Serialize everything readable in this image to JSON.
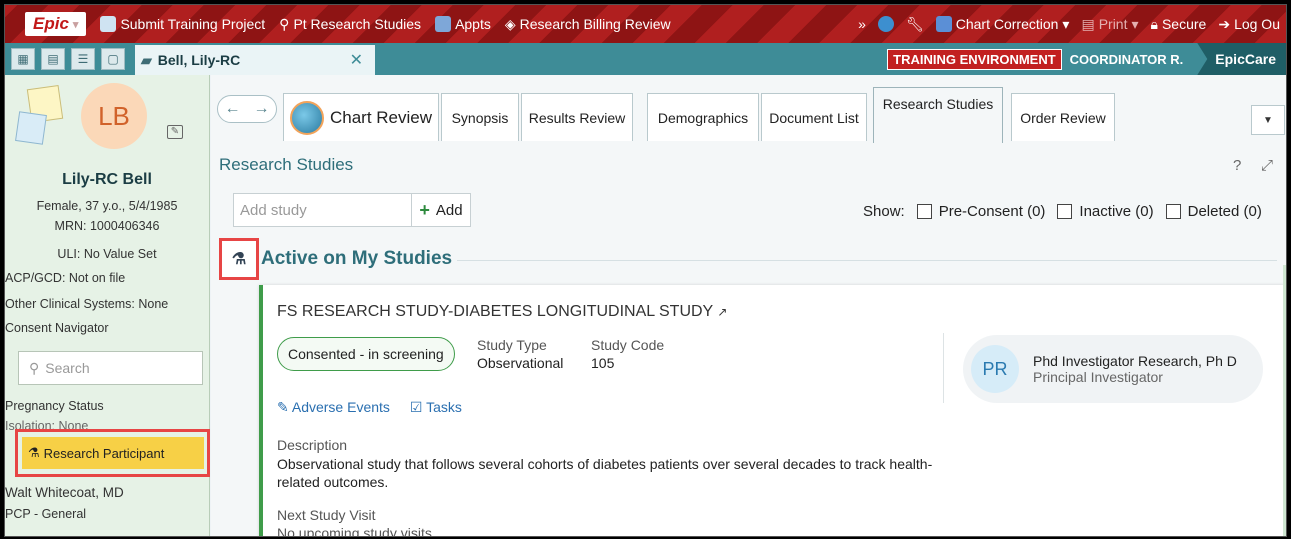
{
  "topbar": {
    "logo": "Epic",
    "items": [
      "Submit Training Project",
      "Pt Research Studies",
      "Appts",
      "Research Billing Review"
    ],
    "chart_correction": "Chart Correction",
    "print": "Print",
    "secure": "Secure",
    "logout": "Log Ou"
  },
  "tabbar": {
    "patient_tab": "Bell, Lily-RC",
    "training": "TRAINING ENVIRONMENT",
    "user": "COORDINATOR R.",
    "app": "EpicCare"
  },
  "sidebar": {
    "initials": "LB",
    "name": "Lily-RC Bell",
    "demographics": "Female, 37 y.o., 5/4/1985",
    "mrn": "MRN: 1000406346",
    "uli": "ULI: No Value Set",
    "acp": "ACP/GCD: Not on file",
    "other_systems": "Other Clinical Systems: None",
    "consent_nav": "Consent Navigator",
    "search_placeholder": "Search",
    "pregnancy": "Pregnancy Status",
    "isolation": "Isolation: None",
    "research_participant": "Research Participant",
    "provider": "Walt Whitecoat, MD",
    "pcp": "PCP - General"
  },
  "tabs": [
    "Chart Review",
    "Synopsis",
    "Results Review",
    "Demographics",
    "Document List",
    "Research Studies",
    "Order Review"
  ],
  "research": {
    "title": "Research Studies",
    "add_placeholder": "Add study",
    "add_label": "Add",
    "show_label": "Show:",
    "pre_consent": "Pre-Consent (0)",
    "inactive": "Inactive (0)",
    "deleted": "Deleted (0)",
    "active_heading": "Active on My Studies",
    "study": {
      "title": "FS RESEARCH STUDY-DIABETES LONGITUDINAL STUDY",
      "status": "Consented - in screening",
      "type_label": "Study Type",
      "type_value": "Observational",
      "code_label": "Study Code",
      "code_value": "105",
      "investigator_initials": "PR",
      "investigator_name": "Phd Investigator Research, Ph D",
      "investigator_role": "Principal Investigator",
      "adverse_events": "Adverse Events",
      "tasks": "Tasks",
      "description_label": "Description",
      "description": "Observational study that follows several cohorts of diabetes patients over several decades to track health-related outcomes.",
      "next_visit_label": "Next Study Visit",
      "next_visit": "No upcoming study visits"
    }
  },
  "colors": {
    "topbar": "#b01f1f",
    "tabbar": "#3e8c97",
    "highlight": "#e74545",
    "status_green": "#3f9c4a"
  }
}
